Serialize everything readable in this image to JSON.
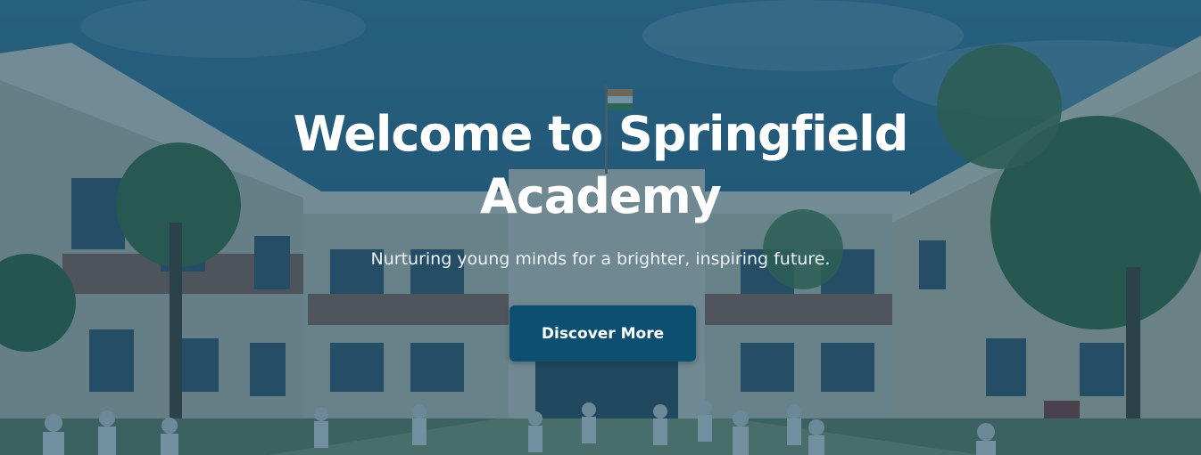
{
  "hero": {
    "title_line1": "Welcome to Springfield",
    "title_line2": "Academy",
    "subtitle": "Nurturing young minds for a brighter, inspiring future.",
    "cta_label": "Discover More"
  },
  "colors": {
    "overlay": "#144866",
    "button_bg": "#0d4f70",
    "text": "#ffffff"
  }
}
